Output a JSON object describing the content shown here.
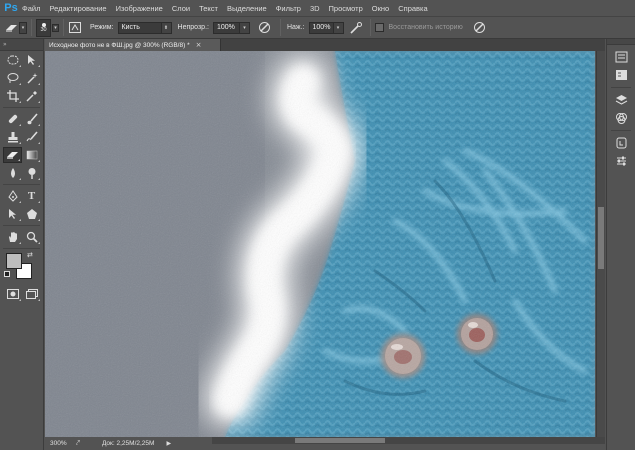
{
  "app": {
    "logo": "Ps"
  },
  "menu": [
    "Файл",
    "Редактирование",
    "Изображение",
    "Слои",
    "Текст",
    "Выделение",
    "Фильтр",
    "3D",
    "Просмотр",
    "Окно",
    "Справка"
  ],
  "options": {
    "brush_size": "30",
    "mode_label": "Режим:",
    "mode_value": "Кисть",
    "opacity_label": "Непрозр.:",
    "opacity_value": "100%",
    "pressure_label": "Наж.:",
    "pressure_value": "100%",
    "restore_history_label": "Восстановить историю"
  },
  "document": {
    "tab_title": "Исходное фото не в ФШ.jpg @ 300% (RGB/8) *",
    "close": "×"
  },
  "status": {
    "zoom": "300%",
    "doc_info": "Док: 2,25M/2,25M"
  },
  "colors": {
    "foreground": "#bdbdbd",
    "background": "#ffffff",
    "accent": "#2fa7f0"
  },
  "toolbox_icons": [
    "rect-marquee-icon",
    "move-icon",
    "lasso-icon",
    "magic-wand-icon",
    "crop-icon",
    "eyedropper-icon",
    "healing-brush-icon",
    "brush-icon",
    "clone-stamp-icon",
    "history-brush-icon",
    "eraser-icon",
    "gradient-icon",
    "blur-icon",
    "dodge-icon",
    "pen-icon",
    "type-icon",
    "path-selection-icon",
    "shape-icon",
    "hand-icon",
    "zoom-icon"
  ],
  "rightpanel_icons": [
    "history-panel-icon",
    "properties-panel-icon",
    "layers-panel-icon",
    "channels-panel-icon",
    "paths-panel-icon",
    "adjustments-panel-icon"
  ]
}
